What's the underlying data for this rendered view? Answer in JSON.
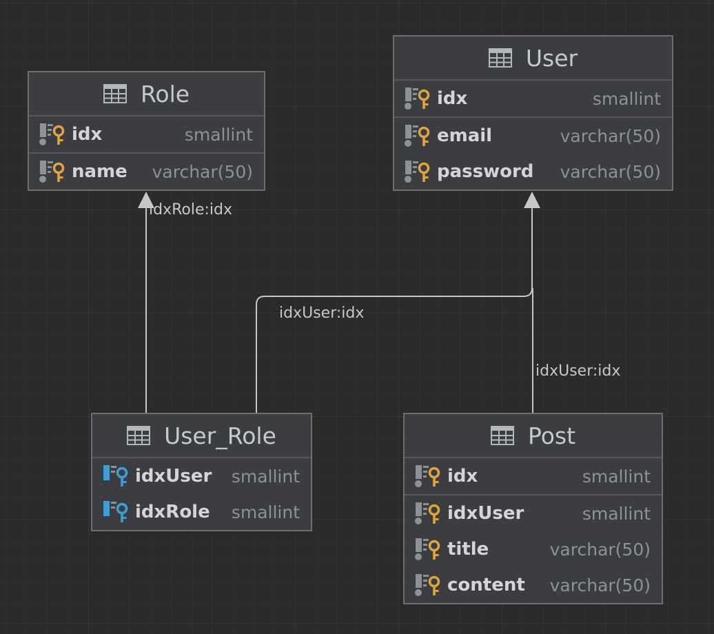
{
  "entities": {
    "role": {
      "title": "Role",
      "columns": [
        {
          "name": "idx",
          "type": "smallint",
          "icon": "primary-key-column-icon"
        },
        {
          "name": "name",
          "type": "varchar(50)",
          "icon": "key-column-icon"
        }
      ]
    },
    "user": {
      "title": "User",
      "columns": [
        {
          "name": "idx",
          "type": "smallint",
          "icon": "primary-key-column-icon"
        },
        {
          "name": "email",
          "type": "varchar(50)",
          "icon": "key-column-icon"
        },
        {
          "name": "password",
          "type": "varchar(50)",
          "icon": "key-column-icon"
        }
      ]
    },
    "user_role": {
      "title": "User_Role",
      "columns": [
        {
          "name": "idxUser",
          "type": "smallint",
          "icon": "foreign-key-column-icon"
        },
        {
          "name": "idxRole",
          "type": "smallint",
          "icon": "foreign-key-column-icon"
        }
      ]
    },
    "post": {
      "title": "Post",
      "columns": [
        {
          "name": "idx",
          "type": "smallint",
          "icon": "primary-key-column-icon"
        },
        {
          "name": "idxUser",
          "type": "smallint",
          "icon": "key-column-icon"
        },
        {
          "name": "title",
          "type": "varchar(50)",
          "icon": "key-column-icon"
        },
        {
          "name": "content",
          "type": "varchar(50)",
          "icon": "key-column-icon"
        }
      ]
    }
  },
  "relations": [
    {
      "from": "User_Role",
      "to": "Role",
      "label": "idxRole:idx"
    },
    {
      "from": "User_Role",
      "to": "User",
      "label": "idxUser:idx"
    },
    {
      "from": "Post",
      "to": "User",
      "label": "idxUser:idx"
    }
  ],
  "colors": {
    "canvas": "#2b2b2b",
    "entity_bg": "#3b3d40",
    "entity_border": "#6c6e71",
    "key_gold": "#e1a53d",
    "key_blue": "#3d9fd6",
    "wire": "#c8c8c8"
  }
}
